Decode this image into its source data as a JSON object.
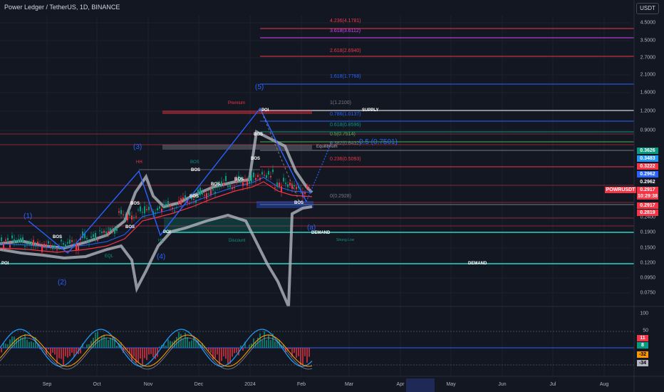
{
  "header": {
    "title": "Power Ledger / TetherUS, 1D, BINANCE",
    "currency_button": "USDT"
  },
  "price_axis": {
    "ticks": [
      "4.5000",
      "3.5000",
      "2.7000",
      "2.1000",
      "1.6000",
      "1.2000",
      "0.9000",
      "0.2400",
      "0.1900",
      "0.1500",
      "0.1200",
      "0.0950",
      "0.0750"
    ],
    "badges": [
      {
        "text": "0.3626",
        "color": "#089981",
        "text_color": "#ffffff"
      },
      {
        "text": "0.3483",
        "color": "#2196f3",
        "text_color": "#ffffff"
      },
      {
        "text": "0.3222",
        "color": "#f23645",
        "text_color": "#ffffff"
      },
      {
        "text": "0.2962",
        "color": "#2962ff",
        "text_color": "#ffffff"
      },
      {
        "text": "0.2962",
        "color": "#131722",
        "text_color": "#ffffff"
      },
      {
        "text": "0.2917",
        "color": "#f23645",
        "text_color": "#ffffff"
      },
      {
        "text": "10:29:38",
        "color": "#f23645",
        "text_color": "#ffffff"
      },
      {
        "text": "0.2917",
        "color": "#f23645",
        "text_color": "#ffffff"
      },
      {
        "text": "0.2819",
        "color": "#f23645",
        "text_color": "#ffffff"
      }
    ],
    "symbol_tag": "POWRUSDT"
  },
  "osc_axis": {
    "ticks": [
      "100",
      "50"
    ],
    "badges": [
      {
        "text": "11",
        "color": "#f23645",
        "text_color": "#ffffff"
      },
      {
        "text": "8",
        "color": "#089981",
        "text_color": "#ffffff"
      },
      {
        "text": "-32",
        "color": "#ff9800",
        "text_color": "#000000"
      },
      {
        "text": "-34",
        "color": "#b2b5be",
        "text_color": "#000000"
      }
    ]
  },
  "time_axis": {
    "labels": [
      "Sep",
      "Oct",
      "Nov",
      "Dec",
      "2024",
      "Feb",
      "Mar",
      "Apr",
      "May",
      "Jun",
      "Jul",
      "Aug"
    ],
    "highlight": ""
  },
  "fib_levels": [
    {
      "text": "4.236(4.1781)",
      "color": "#f23645"
    },
    {
      "text": "3.618(3.6112)",
      "color": "#e040fb"
    },
    {
      "text": "2.618(2.6940)",
      "color": "#f23645"
    },
    {
      "text": "1.618(1.7768)",
      "color": "#2962ff"
    },
    {
      "text": "1(1.2100)",
      "color": "#787b86"
    },
    {
      "text": "0.786(1.0137)",
      "color": "#2962ff"
    },
    {
      "text": "0.618(0.8596)",
      "color": "#089981"
    },
    {
      "text": "0.5(0.7514)",
      "color": "#4caf50"
    },
    {
      "text": "0.382(0.6432)",
      "color": "#787b86"
    },
    {
      "text": "0.236(0.5093)",
      "color": "#f23645"
    },
    {
      "text": "0(0.2928)",
      "color": "#787b86"
    }
  ],
  "annotations": {
    "premium": "Premium",
    "discount": "Discount",
    "equilibrium": "Equilibrium",
    "supply": "SUPPLY",
    "demand_1": "DEMAND",
    "demand_2": "DEMAND",
    "strong_low": "Strong Low",
    "poi_top": "POI",
    "poi_mid": "POI",
    "poi_left": "POI",
    "hh": "HH",
    "hl": "HL",
    "eql": "EQL",
    "bos_labels": [
      "BOS",
      "BOS",
      "BOS",
      "BOS",
      "BOS",
      "BOS",
      "BOS",
      "BOS",
      "BOS",
      "BOS",
      "BOS",
      "BOS"
    ],
    "wave_labels": [
      "(1)",
      "(2)",
      "(3)",
      "(4)",
      "(5)",
      "(a)"
    ],
    "target_label": "0.5 (0.7501)"
  },
  "colors": {
    "background": "#131722",
    "bull": "#089981",
    "bear": "#f23645",
    "wave": "#2962ff",
    "band": "#b2b5be"
  }
}
